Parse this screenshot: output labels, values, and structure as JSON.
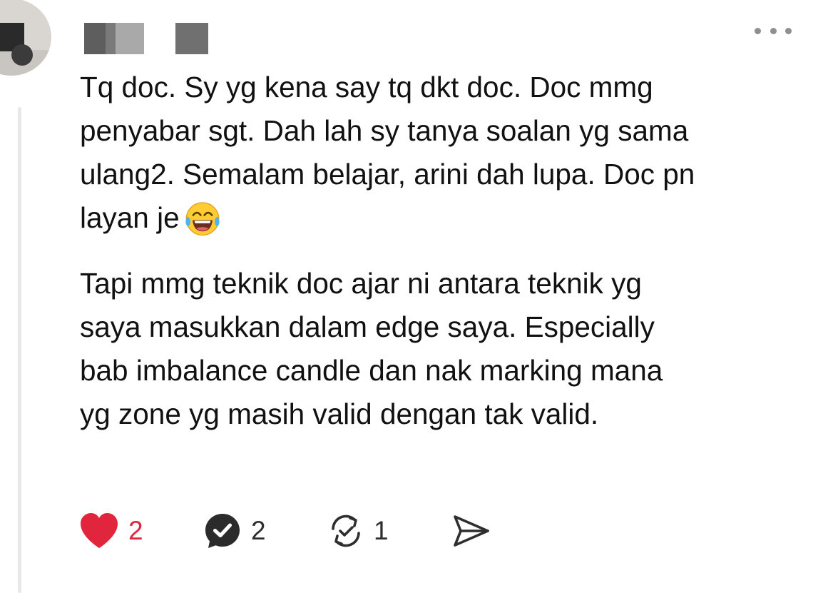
{
  "post": {
    "paragraph1_text": "Tq doc. Sy yg kena say tq dkt doc. Doc mmg\npenyabar sgt. Dah lah sy tanya soalan yg sama\nulang2. Semalam belajar, arini dah lupa. Doc pn\nlayan je",
    "paragraph1_emoji": "laughing-with-tears-emoji",
    "paragraph2": "Tapi mmg teknik doc ajar ni antara teknik yg\nsaya masukkan dalam edge saya. Especially\nbab imbalance candle dan nak marking mana\nyg zone yg masih valid dengan tak valid."
  },
  "actions": {
    "like_count": "2",
    "reply_count": "2",
    "repost_count": "1"
  },
  "icons": {
    "like": "heart-icon",
    "reply": "comment-check-icon",
    "repost": "repost-icon",
    "share": "send-icon",
    "more": "more-dots-icon"
  },
  "colors": {
    "like_active": "#e0253c",
    "text": "#111111",
    "icon": "#2e2e2e",
    "muted": "#8f8f8f"
  }
}
